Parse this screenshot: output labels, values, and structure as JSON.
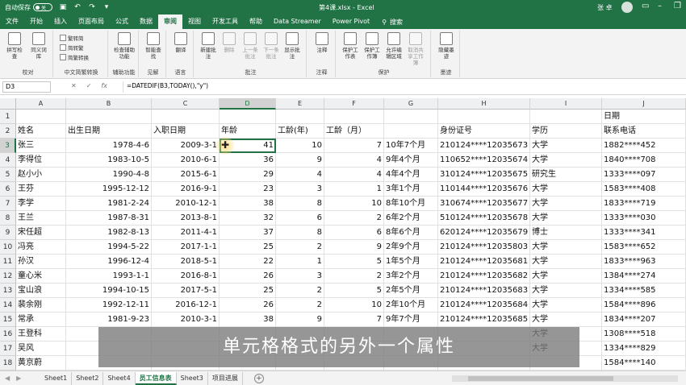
{
  "titlebar": {
    "autosave_label": "自动保存",
    "autosave_state": "关",
    "doc_title": "第4课.xlsx - Excel",
    "user": "张 卓"
  },
  "tabs": [
    "文件",
    "开始",
    "插入",
    "页面布局",
    "公式",
    "数据",
    "审阅",
    "视图",
    "开发工具",
    "帮助",
    "Data Streamer",
    "Power Pivot"
  ],
  "active_tab": "审阅",
  "tellme": "搜索",
  "ribbon": {
    "groups": [
      {
        "label": "校对",
        "buttons": [
          "拼写检查",
          "同义词库"
        ],
        "small": [
          "繁转简",
          "简转繁",
          "简繁转换"
        ]
      },
      {
        "label": "中文简繁转换",
        "buttons": []
      },
      {
        "label": "辅助功能",
        "buttons": [
          "检查辅助功能"
        ]
      },
      {
        "label": "见解",
        "buttons": [
          "智能查找"
        ]
      },
      {
        "label": "语言",
        "buttons": [
          "翻译"
        ]
      },
      {
        "label": "批注",
        "buttons": [
          "新建批注",
          "删除",
          "上一条批注",
          "下一条批注",
          "显示批注"
        ]
      },
      {
        "label": "注释",
        "buttons": [
          "注释"
        ]
      },
      {
        "label": "保护",
        "buttons": [
          "保护工作表",
          "保护工作簿",
          "允许编辑区域",
          "取消共享工作簿"
        ]
      },
      {
        "label": "墨迹",
        "buttons": [
          "隐藏墨迹"
        ]
      }
    ]
  },
  "formula_bar": {
    "name_box": "D3",
    "formula": "=DATEDIF(B3,TODAY(),\"y\")"
  },
  "columns": [
    "A",
    "B",
    "C",
    "D",
    "E",
    "F",
    "G",
    "H",
    "I",
    "J"
  ],
  "selected_column": "D",
  "selected_row": "3",
  "row1": {
    "J": "日期"
  },
  "header_row": [
    "姓名",
    "出生日期",
    "入职日期",
    "年龄",
    "工龄(年)",
    "工龄（月）",
    "",
    "身份证号",
    "学历",
    "联系电话"
  ],
  "rows": [
    [
      "张三",
      "1978-4-6",
      "2009-3-1",
      "41",
      "10",
      "7",
      "10年7个月",
      "210124****12035673",
      "大学",
      "1882****452"
    ],
    [
      "李得位",
      "1983-10-5",
      "2010-6-1",
      "36",
      "9",
      "4",
      "9年4个月",
      "110652****12035674",
      "大学",
      "1840****708"
    ],
    [
      "赵小小",
      "1990-4-8",
      "2015-6-1",
      "29",
      "4",
      "4",
      "4年4个月",
      "310124****12035675",
      "研究生",
      "1333****097"
    ],
    [
      "王芬",
      "1995-12-12",
      "2016-9-1",
      "23",
      "3",
      "1",
      "3年1个月",
      "110144****12035676",
      "大学",
      "1583****408"
    ],
    [
      "李学",
      "1981-2-24",
      "2010-12-1",
      "38",
      "8",
      "10",
      "8年10个月",
      "310674****12035677",
      "大学",
      "1833****719"
    ],
    [
      "王兰",
      "1987-8-31",
      "2013-8-1",
      "32",
      "6",
      "2",
      "6年2个月",
      "510124****12035678",
      "大学",
      "1333****030"
    ],
    [
      "宋任超",
      "1982-8-13",
      "2011-4-1",
      "37",
      "8",
      "6",
      "8年6个月",
      "620124****12035679",
      "博士",
      "1333****341"
    ],
    [
      "冯亮",
      "1994-5-22",
      "2017-1-1",
      "25",
      "2",
      "9",
      "2年9个月",
      "210124****12035803",
      "大学",
      "1583****652"
    ],
    [
      "孙汉",
      "1996-12-4",
      "2018-5-1",
      "22",
      "1",
      "5",
      "1年5个月",
      "210124****12035681",
      "大学",
      "1833****963"
    ],
    [
      "童心米",
      "1993-1-1",
      "2016-8-1",
      "26",
      "3",
      "2",
      "3年2个月",
      "210124****12035682",
      "大学",
      "1384****274"
    ],
    [
      "宝山浪",
      "1994-10-15",
      "2017-5-1",
      "25",
      "2",
      "5",
      "2年5个月",
      "210124****12035683",
      "大学",
      "1334****585"
    ],
    [
      "裴余刚",
      "1992-12-11",
      "2016-12-1",
      "26",
      "2",
      "10",
      "2年10个月",
      "210124****12035684",
      "大学",
      "1584****896"
    ],
    [
      "常承",
      "1981-9-23",
      "2010-3-1",
      "38",
      "9",
      "7",
      "9年7个月",
      "210124****12035685",
      "大学",
      "1834****207"
    ],
    [
      "王登科",
      "",
      "",
      "",
      "",
      "",
      "",
      "",
      "大学",
      "1308****518"
    ],
    [
      "吴风",
      "",
      "",
      "",
      "",
      "",
      "",
      "",
      "大学",
      "1334****829"
    ],
    [
      "黄京蔚",
      "",
      "",
      "",
      "",
      "",
      "",
      "",
      "",
      "1584****140"
    ]
  ],
  "row_numbers": [
    "1",
    "2",
    "3",
    "4",
    "5",
    "6",
    "7",
    "8",
    "9",
    "10",
    "11",
    "12",
    "13",
    "14",
    "15",
    "16",
    "17",
    "18"
  ],
  "subtitle": "单元格格式的另外一个属性",
  "sheets": [
    "Sheet1",
    "Sheet2",
    "Sheet4",
    "员工信息表",
    "Sheet3",
    "项目进展"
  ],
  "active_sheet": "员工信息表",
  "colors": {
    "accent": "#217346",
    "ribbon_bg": "#f3f3f3"
  }
}
